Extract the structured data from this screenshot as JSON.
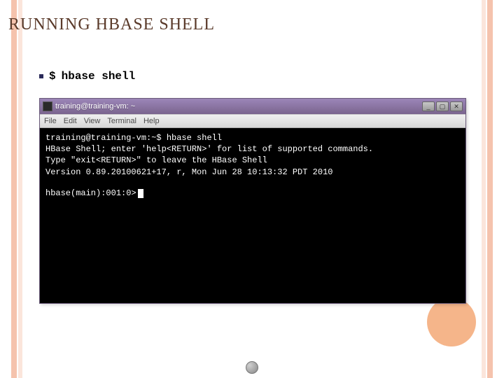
{
  "slide": {
    "title": "RUNNING HBASE SHELL"
  },
  "cmd": {
    "prompt": "$",
    "text": "hbase shell"
  },
  "window": {
    "title": "training@training-vm: ~",
    "menu": {
      "file": "File",
      "edit": "Edit",
      "view": "View",
      "terminal": "Terminal",
      "help": "Help"
    },
    "btns": {
      "min": "_",
      "max": "▢",
      "close": "✕"
    }
  },
  "terminal": {
    "line1": "training@training-vm:~$ hbase shell",
    "line2": "HBase Shell; enter 'help<RETURN>' for list of supported commands.",
    "line3": "Type \"exit<RETURN>\" to leave the HBase Shell",
    "line4": "Version 0.89.20100621+17, r, Mon Jun 28 10:13:32 PDT 2010",
    "prompt": "hbase(main):001:0>"
  }
}
